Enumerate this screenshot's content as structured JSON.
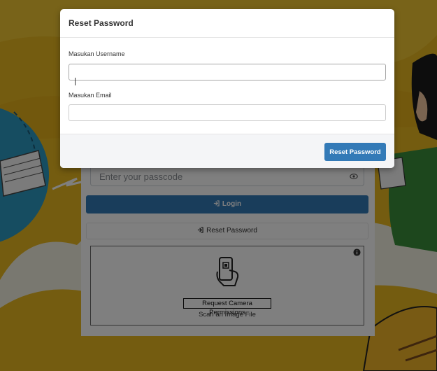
{
  "colors": {
    "primary": "#337ab7",
    "background_yellow": "#e9b821",
    "overlay": "rgba(0,0,0,0.5)"
  },
  "login": {
    "passcode_placeholder": "Enter your passcode",
    "login_label": "Login",
    "reset_password_label": "Reset Password",
    "scanner": {
      "request_camera_label": "Request Camera Permissions",
      "scan_image_label": "Scan an Image File"
    }
  },
  "modal": {
    "title": "Reset Password",
    "username_label": "Masukan Username",
    "username_value": "",
    "email_label": "Masukan Email",
    "email_value": "",
    "submit_label": "Reset Password"
  }
}
